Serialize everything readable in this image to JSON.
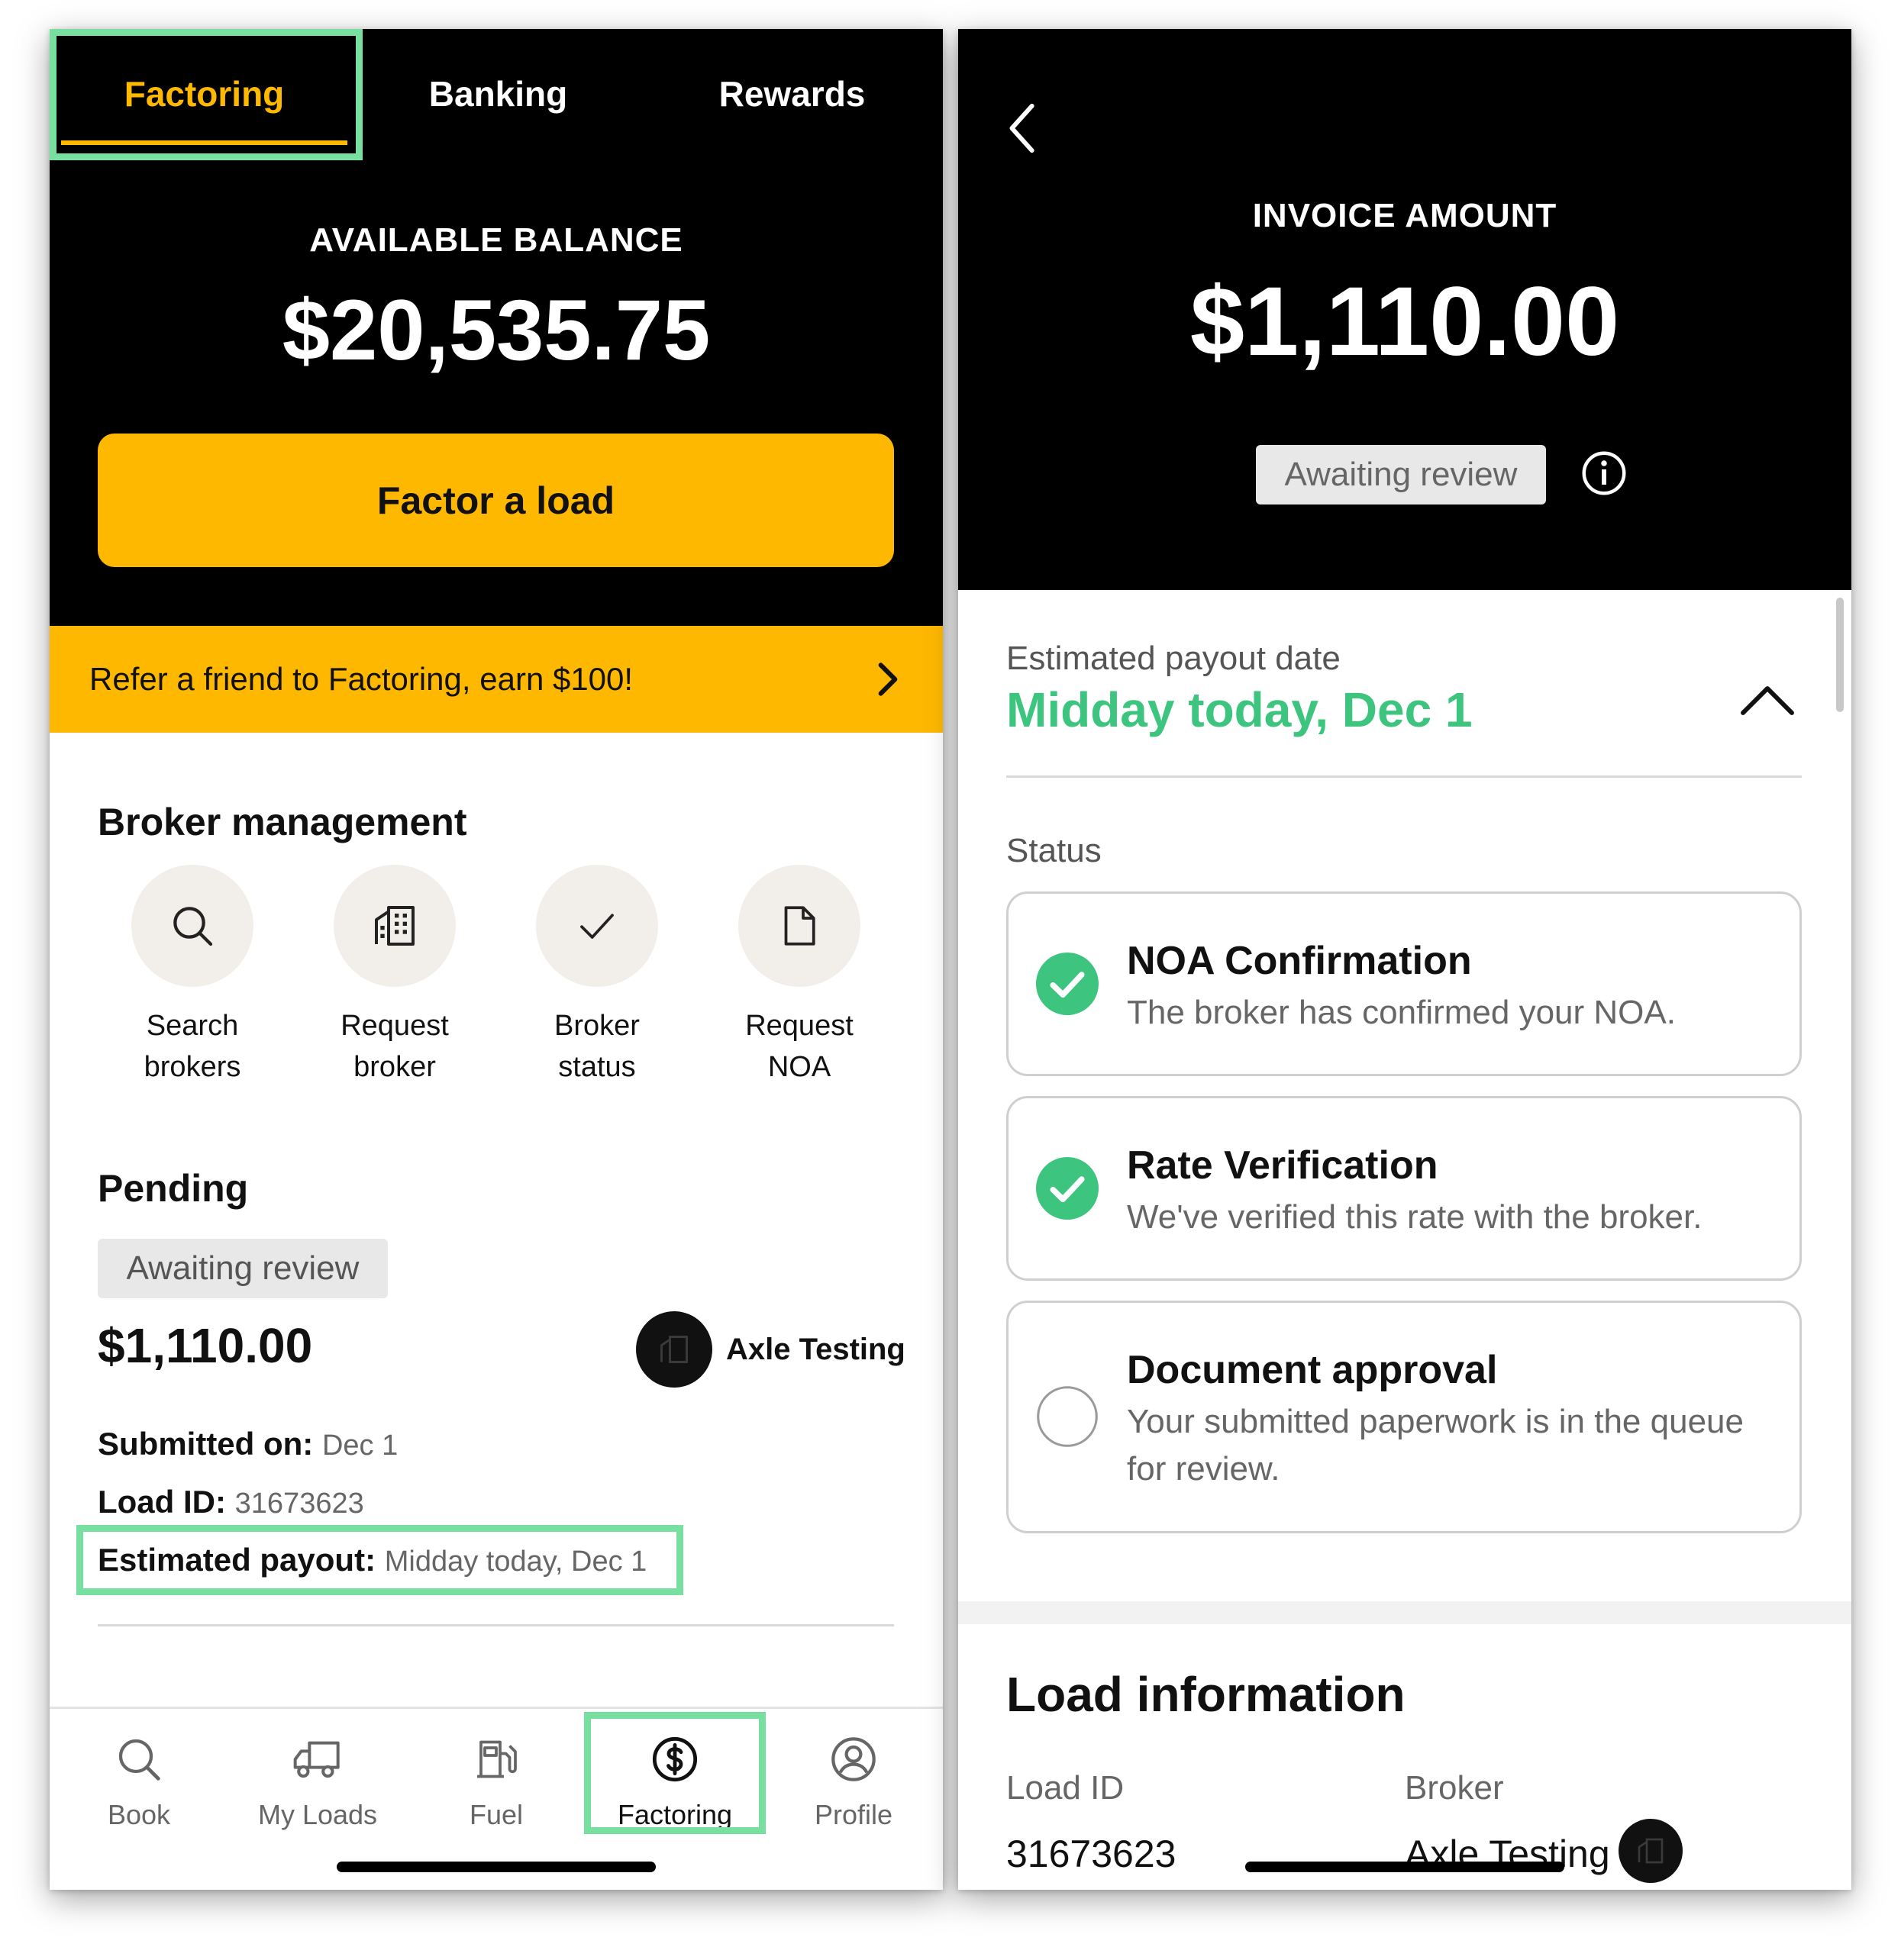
{
  "left": {
    "tabs": [
      {
        "label": "Factoring",
        "active": true
      },
      {
        "label": "Banking",
        "active": false
      },
      {
        "label": "Rewards",
        "active": false
      }
    ],
    "balance_label": "AVAILABLE BALANCE",
    "balance_amount": "$20,535.75",
    "factor_button": "Factor a load",
    "referral_banner": "Refer a friend to Factoring, earn $100!",
    "broker_management": {
      "title": "Broker management",
      "items": [
        {
          "label": "Search\nbrokers",
          "icon": "search-icon"
        },
        {
          "label": "Request\nbroker",
          "icon": "building-icon"
        },
        {
          "label": "Broker\nstatus",
          "icon": "check-icon"
        },
        {
          "label": "Request\nNOA",
          "icon": "document-icon"
        }
      ]
    },
    "pending": {
      "title": "Pending",
      "status": "Awaiting review",
      "amount": "$1,110.00",
      "broker": "Axle Testing",
      "submitted_label": "Submitted on:",
      "submitted_value": "Dec 1",
      "load_id_label": "Load ID:",
      "load_id_value": "31673623",
      "payout_label": "Estimated payout:",
      "payout_value": "Midday today, Dec 1"
    },
    "nav": [
      {
        "label": "Book",
        "icon": "search-icon"
      },
      {
        "label": "My Loads",
        "icon": "truck-icon"
      },
      {
        "label": "Fuel",
        "icon": "fuel-pump-icon"
      },
      {
        "label": "Factoring",
        "icon": "dollar-circle-icon",
        "active": true
      },
      {
        "label": "Profile",
        "icon": "user-circle-icon"
      }
    ]
  },
  "right": {
    "invoice_label": "INVOICE AMOUNT",
    "invoice_amount": "$1,110.00",
    "status_pill": "Awaiting review",
    "payout_label": "Estimated payout date",
    "payout_date": "Midday today, Dec 1",
    "status_label": "Status",
    "steps": [
      {
        "title": "NOA Confirmation",
        "desc": "The broker has confirmed your NOA.",
        "done": true
      },
      {
        "title": "Rate Verification",
        "desc": "We've verified this rate with the broker.",
        "done": true
      },
      {
        "title": "Document approval",
        "desc": "Your submitted paperwork is in the queue for review.",
        "done": false
      }
    ],
    "load_info": {
      "title": "Load information",
      "load_id_label": "Load ID",
      "load_id_value": "31673623",
      "broker_label": "Broker",
      "broker_value": "Axle Testing"
    }
  },
  "colors": {
    "accent_yellow": "#FFB800",
    "success_green": "#3DC47E",
    "highlight_green": "#77E0A0",
    "header_black": "#000000"
  }
}
